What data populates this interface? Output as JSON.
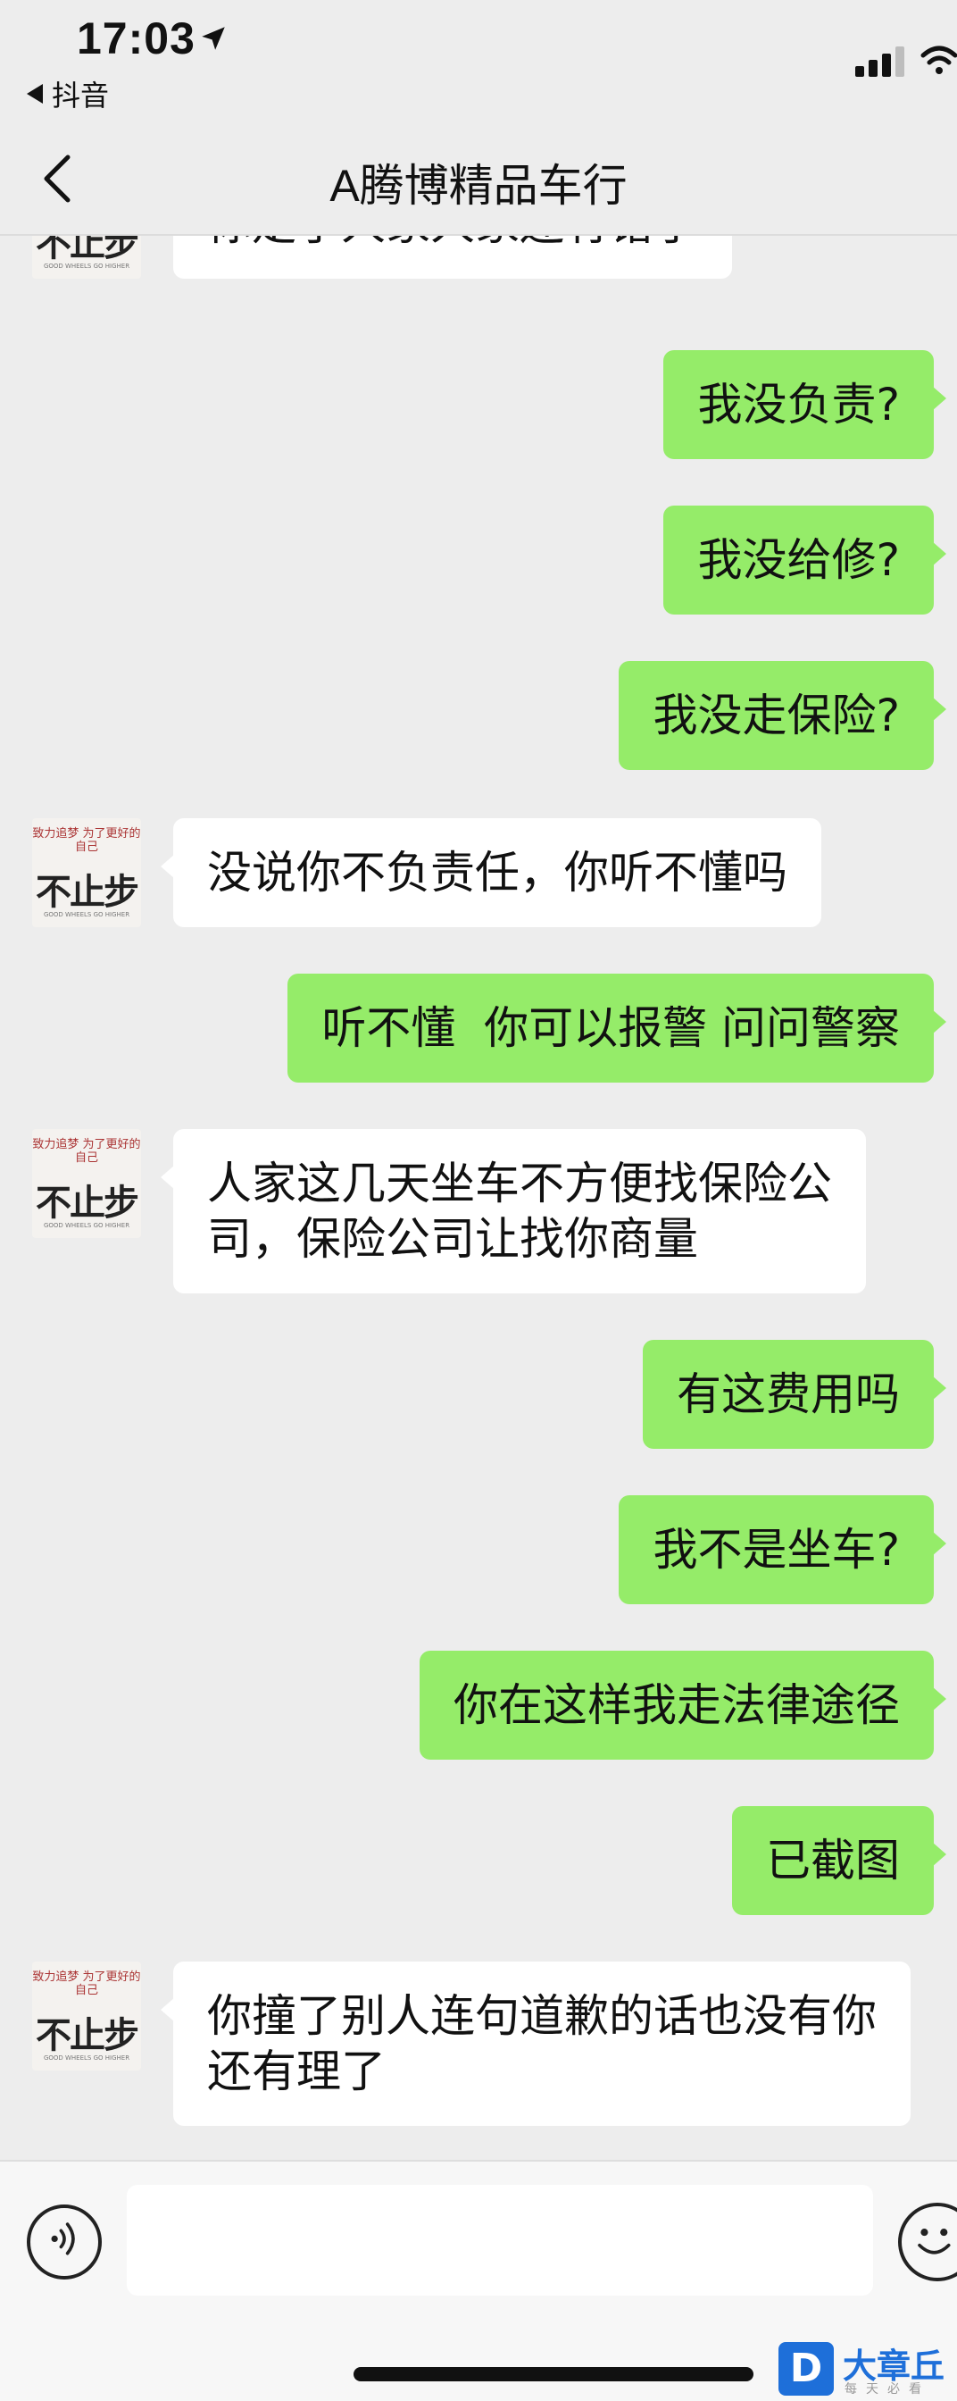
{
  "status_bar": {
    "time": "17:03",
    "back_app_label": "抖音"
  },
  "nav": {
    "title": "A腾博精品车行"
  },
  "avatar": {
    "tiny_text": "致力追梦\n为了更好的自己",
    "brush_text": "不止步",
    "fine_text": "GOOD WHEELS GO HIGHER"
  },
  "messages": [
    {
      "side": "left",
      "text": "你走了人家人家还有错了"
    },
    {
      "side": "right",
      "text": "我没负责?"
    },
    {
      "side": "right",
      "text": "我没给修?"
    },
    {
      "side": "right",
      "text": "我没走保险?"
    },
    {
      "side": "left",
      "text": "没说你不负责任，你听不懂吗"
    },
    {
      "side": "right",
      "text": "听不懂  你可以报警 问问警察"
    },
    {
      "side": "left",
      "text": "人家这几天坐车不方便找保险公\n司，保险公司让找你商量"
    },
    {
      "side": "right",
      "text": "有这费用吗"
    },
    {
      "side": "right",
      "text": "我不是坐车?"
    },
    {
      "side": "right",
      "text": "你在这样我走法律途径"
    },
    {
      "side": "right",
      "text": "已截图"
    },
    {
      "side": "left",
      "text": "你撞了别人连句道歉的话也没有你\n还有理了"
    }
  ],
  "input": {
    "value": "",
    "placeholder": ""
  },
  "watermark": {
    "logo_letter": "D",
    "name": "大章丘",
    "sub": "每天必看"
  },
  "colors": {
    "background": "#ededed",
    "bubble_self": "#95ec69",
    "bubble_other": "#ffffff"
  }
}
